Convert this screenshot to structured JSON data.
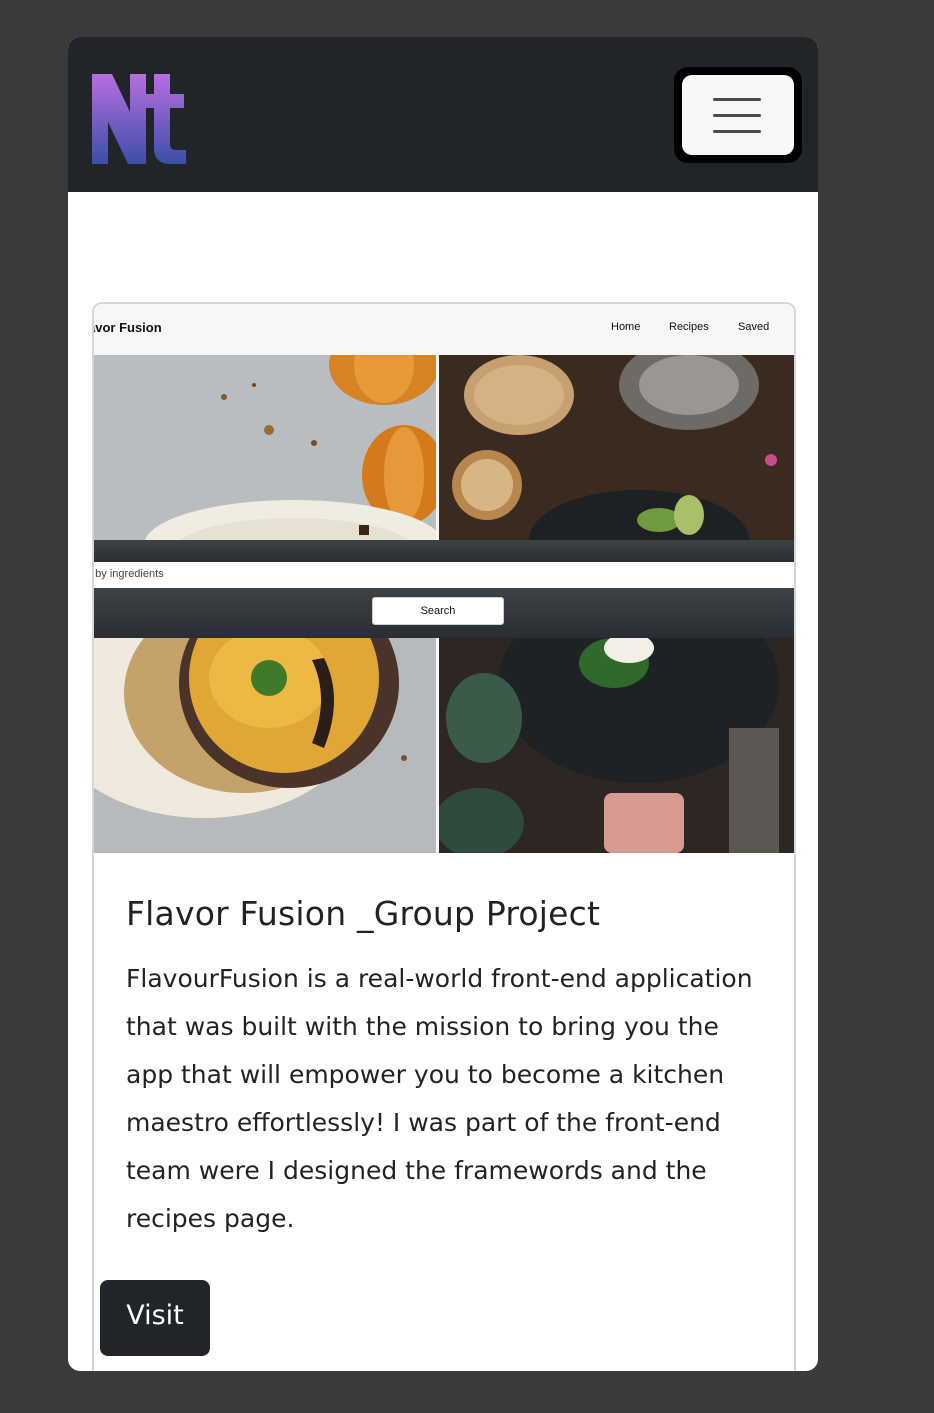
{
  "navbar": {
    "logo_text": "Nt",
    "menu_toggle_icon": "hamburger-icon",
    "colors": {
      "background": "#212529",
      "logo_top": "#b86ee0",
      "logo_bottom": "#3b4fa8"
    }
  },
  "project": {
    "screenshot": {
      "brand": "avor Fusion",
      "nav_links": [
        "Home",
        "Recipes",
        "Saved"
      ],
      "search_placeholder": "h by ingredients",
      "search_button": "Search"
    },
    "title": "Flavor Fusion _Group Project",
    "description": "FlavourFusion is a real-world front-end application that was built with the mission to bring you the app that will empower you to become a kitchen maestro effortlessly! I was part of the front-end team were I designed the framewords and the recipes page.",
    "visit_label": "Visit"
  }
}
